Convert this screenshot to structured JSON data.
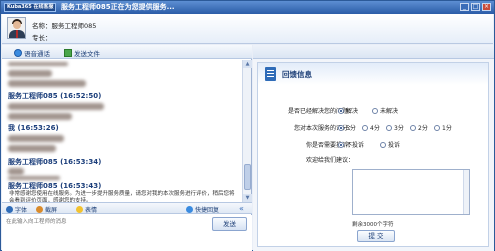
{
  "window": {
    "logo": "Kuba365 在线客服",
    "title": "服务工程师085正在为您提供服务..."
  },
  "profile": {
    "name_label": "名称：服务工程师085",
    "specialty_label": "专长："
  },
  "toolbar_top": {
    "voice": "语音通话",
    "file": "发送文件"
  },
  "chat": {
    "messages": [
      {
        "sender": "服务工程师085",
        "time": "(16:52:50)"
      },
      {
        "sender": "我",
        "time": "(16:53:26)"
      },
      {
        "sender": "服务工程师085",
        "time": "(16:53:34)"
      },
      {
        "sender": "服务工程师085",
        "time": "(16:53:43)"
      }
    ],
    "last_text": "非常感谢您使用在线服务。为进一步提升服务质量，请您对我的本次服务进行评价，稍后您将会看到评价页面，感谢您的支持。"
  },
  "toolbar_bottom": {
    "font": "字体",
    "screenshot": "截屏",
    "emoji": "表情",
    "quick_reply": "快捷回复"
  },
  "input": {
    "placeholder": "在此输入向工程师的消息",
    "send": "发送"
  },
  "feedback": {
    "title": "回馈信息",
    "q1": "是否已经解决您的问题：",
    "q1_options": [
      "解决",
      "未解决"
    ],
    "q2": "您对本次服务的评分：",
    "q2_options": [
      "5分",
      "4分",
      "3分",
      "2分",
      "1分"
    ],
    "q3": "你是否需要投诉：",
    "q3_options": [
      "不投诉",
      "投诉"
    ],
    "q4": "欢迎给我们建议：",
    "remaining": "剩余3000个字符",
    "submit": "提 交"
  }
}
